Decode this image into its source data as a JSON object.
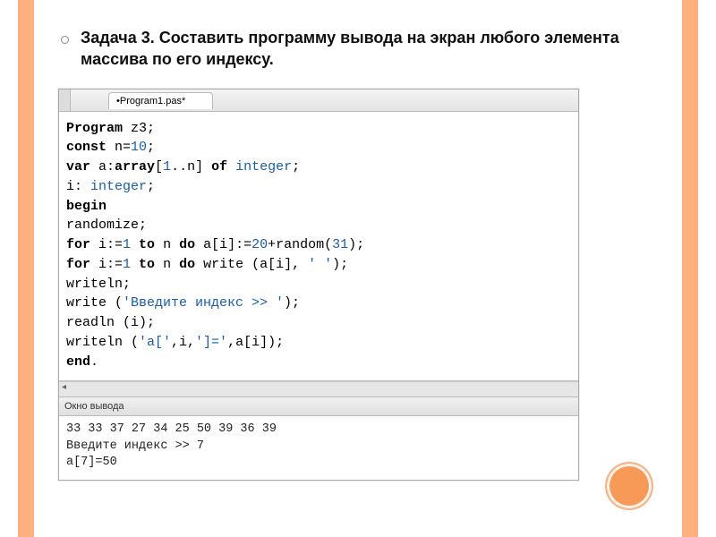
{
  "task": {
    "number_prefix": "Задача 3.",
    "text": "Составить программу вывода на экран любого элемента массива по его индексу."
  },
  "ide": {
    "tab_name": "•Program1.pas*",
    "output_panel_title": "Окно вывода"
  },
  "code": {
    "l1_kw": "Program",
    "l1_id": " z3;",
    "l2_kw": "const",
    "l2_rest": " n=",
    "l2_num": "10",
    "l2_end": ";",
    "l3_kw": "var",
    "l3_a": " a:",
    "l3_arr": "array",
    "l3_br": "[",
    "l3_one": "1",
    "l3_dd": "..n] ",
    "l3_of": "of",
    "l3_sp": " ",
    "l3_int": "integer",
    "l3_sc": ";",
    "l4_i": " i: ",
    "l4_int": "integer",
    "l4_sc": ";",
    "l5": "begin",
    "l6": " randomize;",
    "l7_for": " for",
    "l7_a": " i:=",
    "l7_n1": "1",
    "l7_to": " to",
    "l7_b": " n ",
    "l7_do": "do",
    "l7_c": " a[i]:=",
    "l7_n2": "20",
    "l7_d": "+random(",
    "l7_n3": "31",
    "l7_e": ");",
    "l8_for": " for",
    "l8_a": " i:=",
    "l8_n1": "1",
    "l8_to": " to",
    "l8_b": " n ",
    "l8_do": "do",
    "l8_c": " write (a[i], ",
    "l8_s": "' '",
    "l8_e": ");",
    "l9": " writeln;",
    "l10_a": " write (",
    "l10_s": "'Введите индекс >> '",
    "l10_b": ");",
    "l11": " readln (i);",
    "l12_a": " writeln (",
    "l12_s1": "'a['",
    "l12_b": ",i,",
    "l12_s2": "']='",
    "l12_c": ",a[i]);",
    "l13": "end",
    "l13_dot": "."
  },
  "output": {
    "line1": "33 33 37 27 34 25 50 39 36 39",
    "line2": "Введите индекс >> 7",
    "line3": "a[7]=50"
  }
}
